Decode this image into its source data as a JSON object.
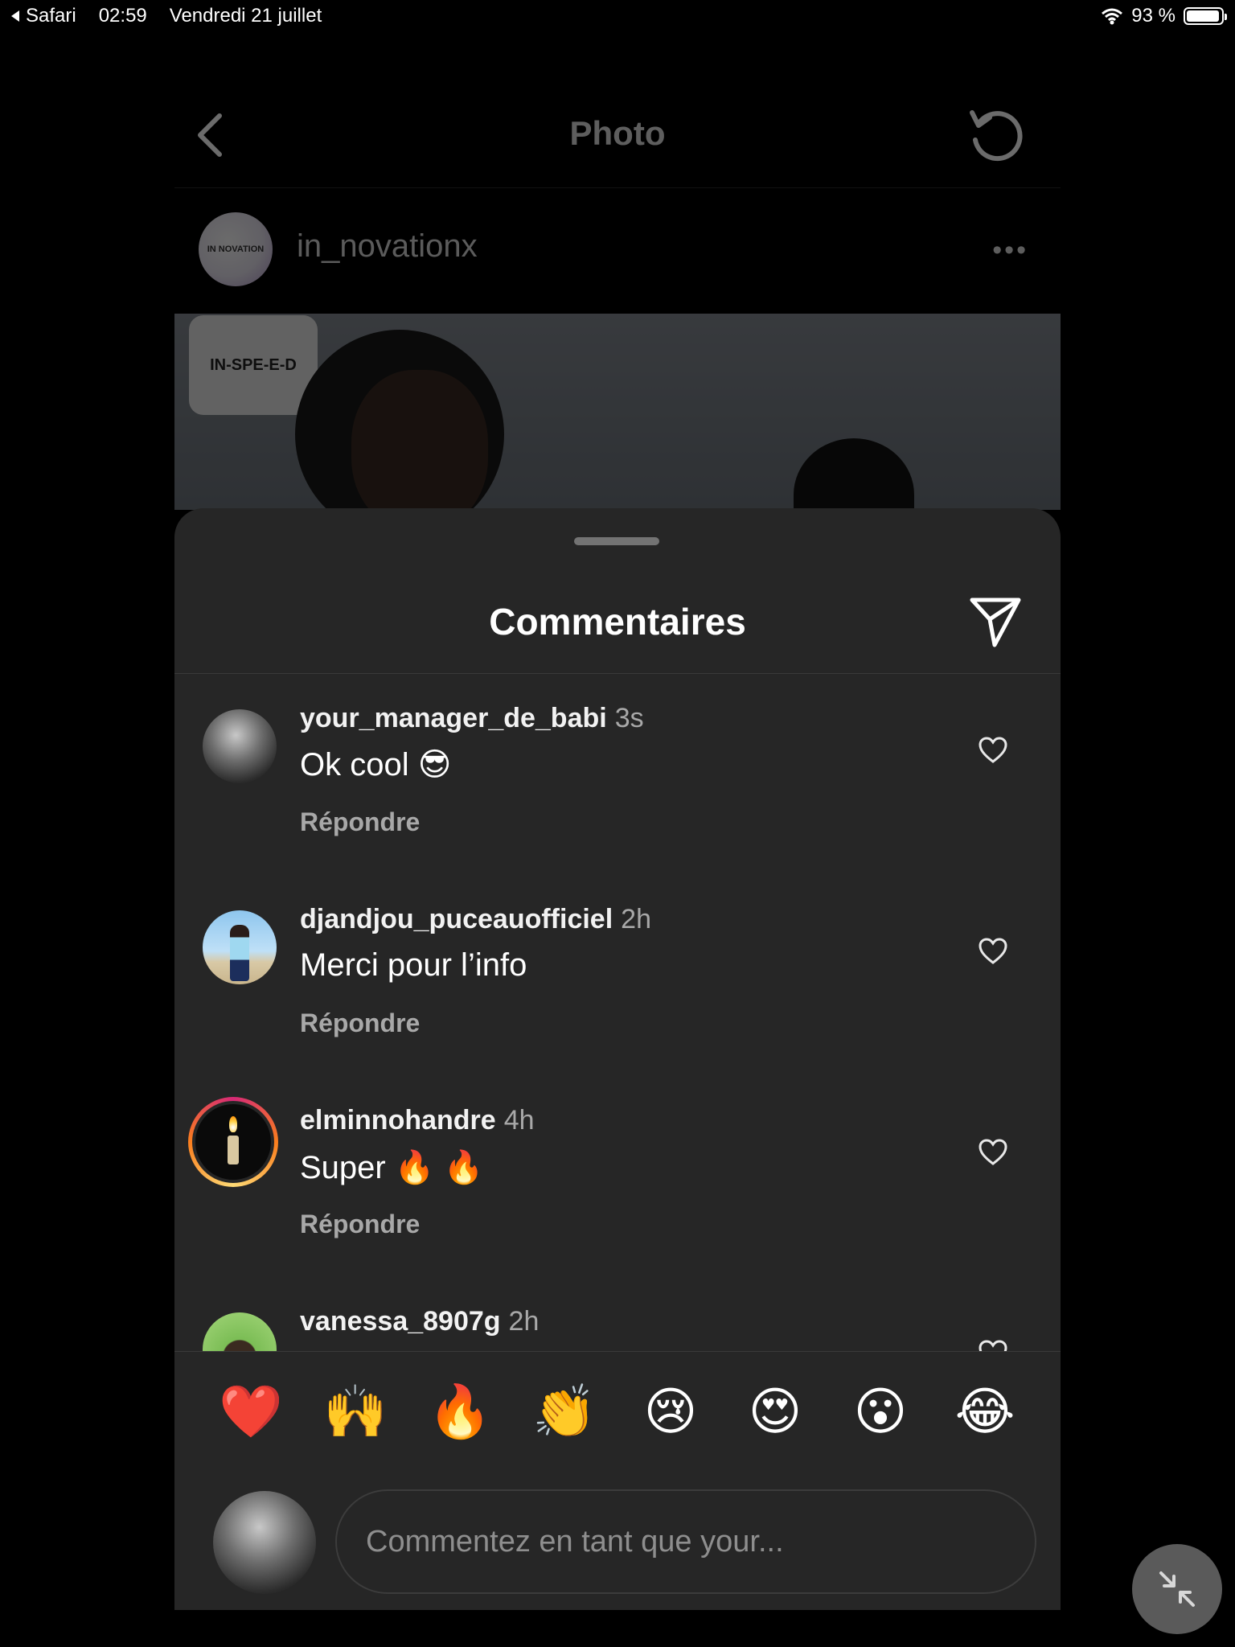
{
  "status_bar": {
    "back_app": "Safari",
    "time": "02:59",
    "date": "Vendredi 21 juillet",
    "battery": "93 %"
  },
  "nav": {
    "title": "Photo"
  },
  "post": {
    "username": "in_novationx",
    "avatar_text": "IN NOVATION",
    "photo_logo_text": "IN-SPE-E-D"
  },
  "comments_sheet": {
    "title": "Commentaires",
    "reply_label": "Répondre",
    "comments": [
      {
        "username": "your_manager_de_babi",
        "time": "3s",
        "text": "Ok cool 😎"
      },
      {
        "username": "djandjou_puceauofficiel",
        "time": "2h",
        "text": "Merci pour l’info"
      },
      {
        "username": "elminnohandre",
        "time": "4h",
        "text": "Super 🔥 🔥"
      },
      {
        "username": "vanessa_8907g",
        "time": "2h",
        "text": ""
      }
    ]
  },
  "quick_reactions": [
    "❤️",
    "🙌",
    "🔥",
    "👏",
    "😢",
    "😍",
    "😮",
    "😂"
  ],
  "composer": {
    "placeholder": "Commentez en tant que your..."
  },
  "colors": {
    "sheet_bg": "#262626",
    "secondary_text": "#a8a8a8",
    "story_ring_start": "#d62976",
    "story_ring_end": "#feda75"
  }
}
